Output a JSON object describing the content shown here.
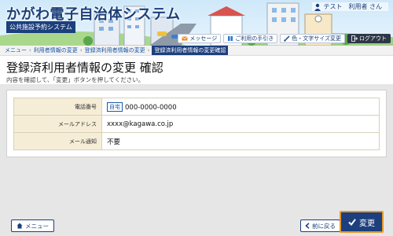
{
  "header": {
    "app_title": "かがわ電子自治体システム",
    "app_subtitle": "公共施設予約システム",
    "user_name": "テスト　利用者 さん",
    "buttons": [
      {
        "label": "メッセージ",
        "icon": "envelope-icon"
      },
      {
        "label": "ご利用の手引き",
        "icon": "book-icon"
      },
      {
        "label": "色・文字サイズ変更",
        "icon": "brush-icon"
      },
      {
        "label": "ログアウト",
        "icon": "logout-icon"
      }
    ]
  },
  "breadcrumb": [
    "メニュー",
    "利用者情報の変更",
    "登録済利用者情報の変更",
    "登録済利用者情報の変更確認"
  ],
  "page": {
    "title": "登録済利用者情報の変更 確認",
    "description": "内容を確認して、「変更」ボタンを押してください。"
  },
  "info": {
    "rows": [
      {
        "label": "電話番号",
        "tag": "自宅",
        "value": "000-0000-0000"
      },
      {
        "label": "メールアドレス",
        "value": "xxxx@kagawa.co.jp"
      },
      {
        "label": "メール通知",
        "value": "不要"
      }
    ]
  },
  "footer": {
    "menu_label": "メニュー",
    "back_label": "前に戻る",
    "change_label": "変更"
  },
  "colors": {
    "navy": "#1d3f7d",
    "accent_orange": "#e39a2c",
    "label_bg": "#f5edd6",
    "main_bg": "#e6e6e6"
  }
}
